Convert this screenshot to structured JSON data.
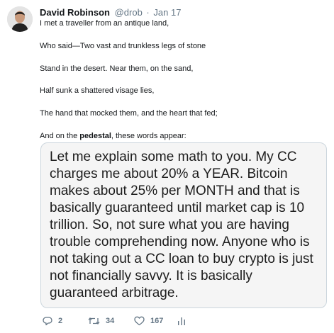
{
  "tweet": {
    "author_name": "David Robinson",
    "handle": "@drob",
    "separator": "·",
    "date": "Jan 17",
    "lines": [
      "I met a traveller from an antique land,",
      "Who said—Two vast and trunkless legs of stone",
      "Stand in the desert. Near them, on the sand,",
      "Half sunk a shattered visage lies,",
      "The hand that mocked them, and the heart that fed;"
    ],
    "last_line_before": "And on the ",
    "last_line_bold": "pedestal",
    "last_line_after": ", these words appear:",
    "quote_text": "Let me explain some math to you. My CC charges me about 20% a YEAR. Bitcoin makes about 25% per MONTH and that is basically guaranteed until market cap is 10 trillion. So, not sure what you are having trouble comprehending now. Anyone who is not taking out a CC loan to buy crypto is just not financially savvy. It is basically guaranteed arbitrage.",
    "actions": {
      "reply_count": "2",
      "retweet_count": "34",
      "like_count": "167"
    }
  },
  "colors": {
    "text": "#14171a",
    "secondary": "#657786",
    "quote_bg": "#f5f5f5",
    "border": "#ccd6dd"
  },
  "icons": [
    "reply-icon",
    "retweet-icon",
    "like-icon",
    "analytics-icon"
  ]
}
